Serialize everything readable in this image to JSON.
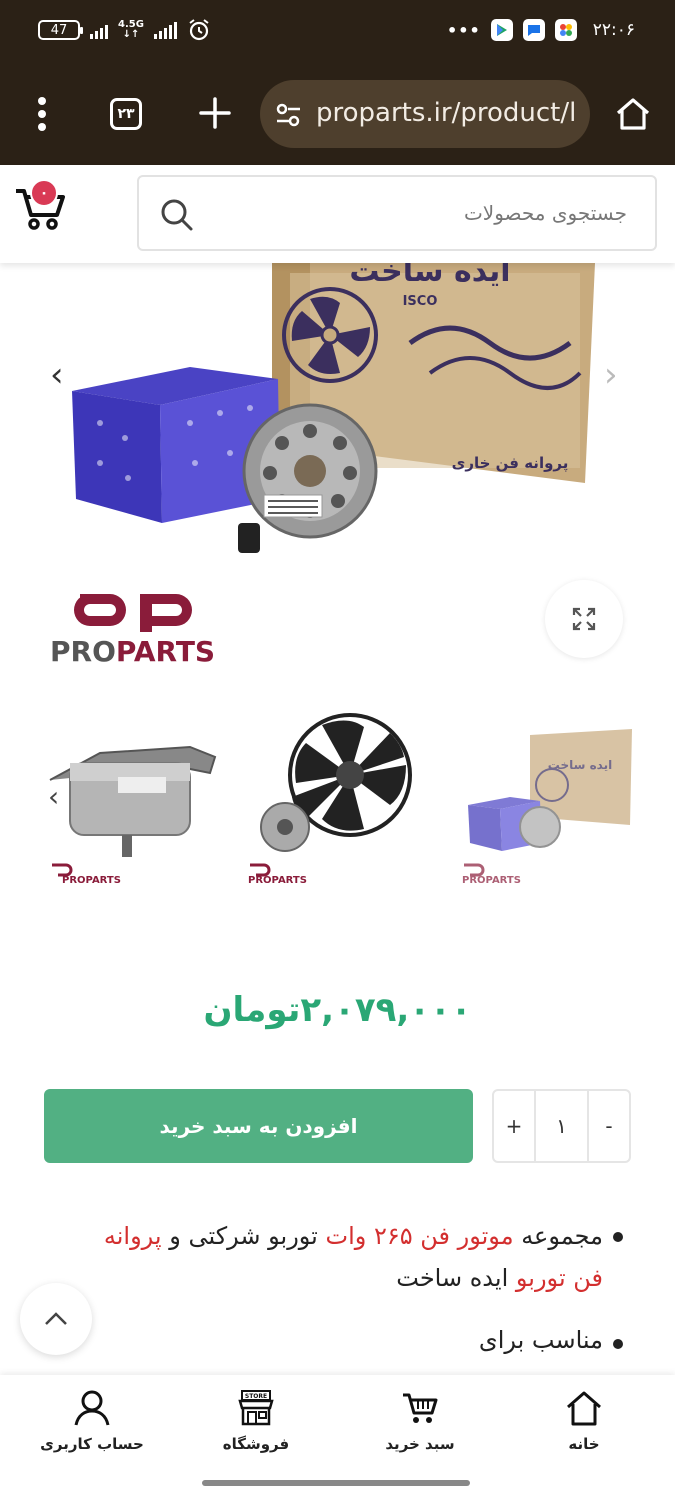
{
  "status_bar": {
    "battery": "47",
    "network": "4.5G",
    "time": "۲۲:۰۶",
    "more": "•••"
  },
  "browser": {
    "url": "proparts.ir/product/l",
    "tab_count": "۲۳"
  },
  "header": {
    "search_placeholder": "جستجوی محصولات",
    "cart_count": "۰"
  },
  "gallery": {
    "box_brand": "ISCO",
    "box_label": "پروانه فن خاری",
    "box_top": "ایده ساخت",
    "logo_text_pro": "PRO",
    "logo_text_parts": "PARTS",
    "thumb_logo": "PROPARTS"
  },
  "product": {
    "price": "۲,۰۷۹,۰۰۰تومان",
    "add_to_cart_label": "افزودن به سبد خرید",
    "quantity": "۱",
    "qty_plus": "+",
    "qty_minus": "-"
  },
  "description": {
    "line1_a": "مجموعه ",
    "line1_b": "موتور فن ۲۶۵ وات",
    "line1_c": " توربو شرکتی و ",
    "line1_d": "پروانه",
    "line2_a": "فن توربو",
    "line2_b": " ایده ساخت",
    "line3": "مناسب برای"
  },
  "bottom_nav": {
    "home": "خانه",
    "cart": "سبد خرید",
    "store": "فروشگاه",
    "account": "حساب کاربری",
    "store_sign": "STORE"
  }
}
